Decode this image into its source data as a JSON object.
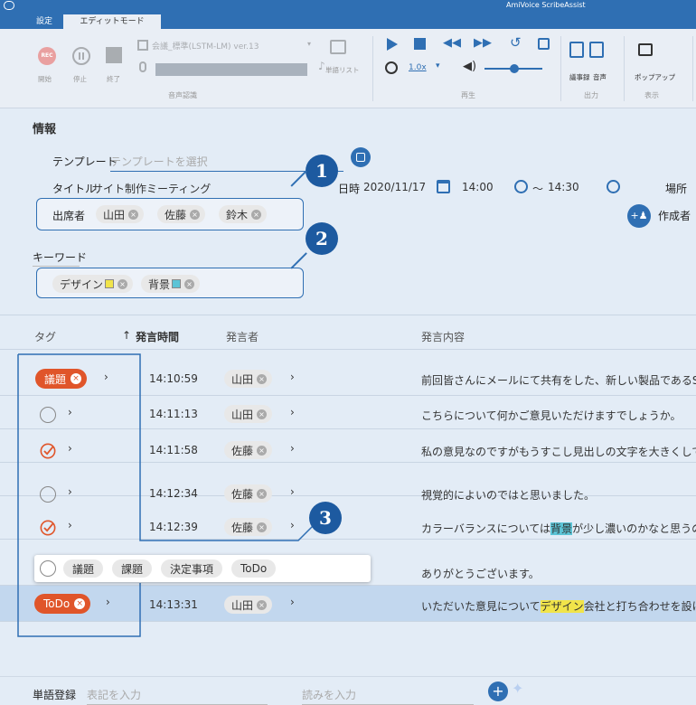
{
  "app": {
    "title": "AmiVoice ScribeAssist"
  },
  "tabs": [
    {
      "label": "設定"
    },
    {
      "label": "エディットモード"
    }
  ],
  "ribbon": {
    "rec": {
      "badge": "REC",
      "label": "開始"
    },
    "pause_label": "停止",
    "stop_label": "終了",
    "model_select": "会議_標準(LSTM-LM) ver.13",
    "word_list_label": "単語リスト",
    "speed": "1.0x",
    "output": {
      "minutes_label": "議事録",
      "audio_label": "音声"
    },
    "display": {
      "popup_label": "ポップアップ"
    },
    "groups": {
      "recognition": "音声認識",
      "playback": "再生",
      "output": "出力",
      "display": "表示"
    }
  },
  "info": {
    "title": "情報",
    "template_label": "テンプレート",
    "template_placeholder": "テンプレートを選択",
    "title_label": "タイトル",
    "title_value": "サイト制作ミーティング",
    "datetime_label": "日時",
    "date": "2020/11/17",
    "start_time": "14:00",
    "end_prefix": "〜",
    "end_time": "14:30",
    "place_label": "場所",
    "creator_label": "作成者",
    "attendees_label": "出席者",
    "attendees": [
      "山田",
      "佐藤",
      "鈴木"
    ],
    "keywords_label": "キーワード",
    "keywords": [
      {
        "text": "デザイン",
        "color": "#f1e44a"
      },
      {
        "text": "背景",
        "color": "#5cc4d6"
      }
    ]
  },
  "callouts": [
    "1",
    "2",
    "3"
  ],
  "table": {
    "headers": {
      "tag": "タグ",
      "sort_arrow": "↑",
      "time": "発言時間",
      "speaker": "発言者",
      "content": "発言内容"
    },
    "rows": [
      {
        "tag": "議題",
        "time": "14:10:59",
        "speaker": "山田",
        "text": "前回皆さんにメールにて共有をした、新しい製品であるScr"
      },
      {
        "time": "14:11:13",
        "speaker": "山田",
        "text": "こちらについて何かご意見いただけますでしょうか。"
      },
      {
        "time": "14:11:58",
        "speaker": "佐藤",
        "text": "私の意見なのですがもうすこし見出しの文字を大きくしても"
      },
      {
        "time": "14:12:34",
        "speaker": "佐藤",
        "text": "視覚的によいのではと思いました。"
      },
      {
        "time": "14:12:39",
        "speaker": "佐藤",
        "text_before": "カラーバランスについては",
        "text_highlight": "背景",
        "text_after": "が少し濃いのかなと思うので、"
      },
      {
        "text": "ありがとうございます。"
      },
      {
        "tag": "ToDo",
        "time": "14:13:31",
        "speaker": "山田",
        "text_before": "いただいた意見について",
        "text_highlight": "デザイン",
        "text_after": "会社と打ち合わせを設けて"
      }
    ],
    "tag_options": [
      "議題",
      "課題",
      "決定事項",
      "ToDo"
    ]
  },
  "bottom": {
    "word_register_label": "単語登録",
    "notation_placeholder": "表記を入力",
    "reading_placeholder": "読みを入力"
  },
  "colors": {
    "accent": "#2f6fb3",
    "tag_red": "#e0552a",
    "callout": "#1d5aa0",
    "selected_row": "#c2d7ee"
  }
}
